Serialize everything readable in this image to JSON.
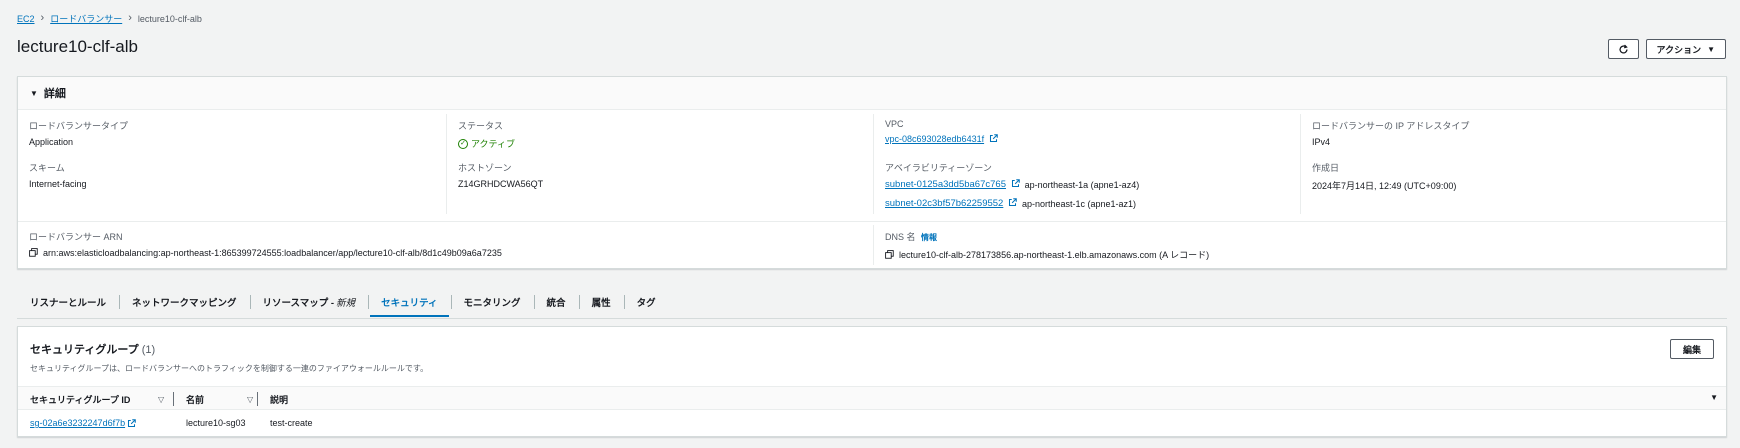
{
  "breadcrumb": {
    "items": [
      "EC2",
      "ロードバランサー"
    ],
    "current": "lecture10-clf-alb"
  },
  "page": {
    "title": "lecture10-clf-alb",
    "actions_label": "アクション"
  },
  "details": {
    "section_title": "詳細",
    "lb_type_label": "ロードバランサータイプ",
    "lb_type_value": "Application",
    "status_label": "ステータス",
    "status_value": "アクティブ",
    "vpc_label": "VPC",
    "vpc_value": "vpc-08c693028edb6431f",
    "ip_type_label": "ロードバランサーの IP アドレスタイプ",
    "ip_type_value": "IPv4",
    "scheme_label": "スキーム",
    "scheme_value": "Internet-facing",
    "hosted_zone_label": "ホストゾーン",
    "hosted_zone_value": "Z14GRHDCWA56QT",
    "az_label": "アベイラビリティーゾーン",
    "subnets": [
      {
        "id": "subnet-0125a3dd5ba67c765",
        "zone": "ap-northeast-1a (apne1-az4)"
      },
      {
        "id": "subnet-02c3bf57b62259552",
        "zone": "ap-northeast-1c (apne1-az1)"
      }
    ],
    "created_label": "作成日",
    "created_value": "2024年7月14日, 12:49 (UTC+09:00)",
    "arn_label": "ロードバランサー ARN",
    "arn_value": "arn:aws:elasticloadbalancing:ap-northeast-1:865399724555:loadbalancer/app/lecture10-clf-alb/8d1c49b09a6a7235",
    "dns_label": "DNS 名",
    "dns_info": "情報",
    "dns_value": "lecture10-clf-alb-278173856.ap-northeast-1.elb.amazonaws.com (A レコード)"
  },
  "tabs": [
    {
      "label": "リスナーとルール"
    },
    {
      "label": "ネットワークマッピング"
    },
    {
      "label": "リソースマップ - ",
      "extra": "新規"
    },
    {
      "label": "セキュリティ"
    },
    {
      "label": "モニタリング"
    },
    {
      "label": "統合"
    },
    {
      "label": "属性"
    },
    {
      "label": "タグ"
    }
  ],
  "active_tab": "セキュリティ",
  "security_groups": {
    "title": "セキュリティグループ",
    "count": "(1)",
    "description": "セキュリティグループは、ロードバランサーへのトラフィックを制御する一連のファイアウォールルールです。",
    "edit_label": "編集",
    "columns": [
      "セキュリティグループ ID",
      "名前",
      "説明"
    ],
    "rows": [
      {
        "id": "sg-02a6e3232247d6f7b",
        "name": "lecture10-sg03",
        "description": "test-create"
      }
    ]
  },
  "colors": {
    "link": "#0073bb",
    "success": "#1d8102",
    "background": "#f2f3f3"
  }
}
